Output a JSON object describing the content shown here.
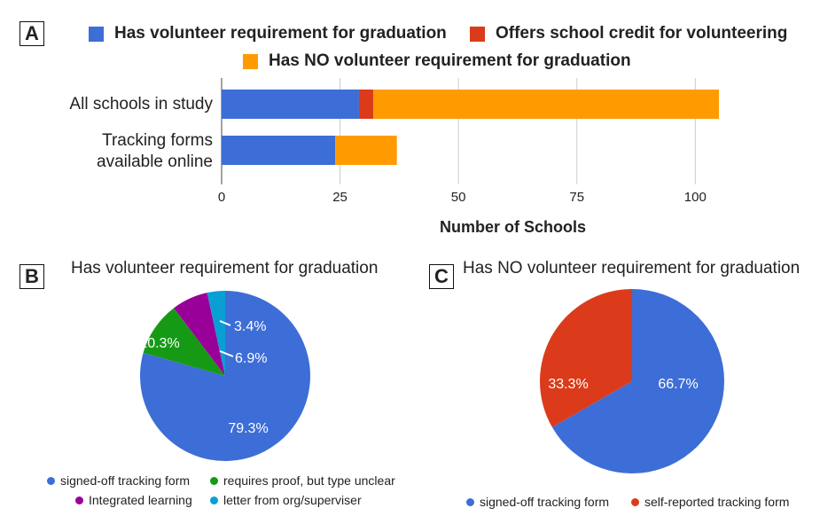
{
  "colors": {
    "blue": "#3D6DD6",
    "red": "#DB3B1A",
    "orange": "#FF9B00",
    "green": "#169A16",
    "purple": "#990099",
    "cyan": "#0A9FD4"
  },
  "panels": {
    "a": "A",
    "b": "B",
    "c": "C"
  },
  "chart_data": [
    {
      "type": "bar",
      "orientation": "horizontal",
      "stacked": true,
      "categories": [
        "All schools in study",
        "Tracking forms available online"
      ],
      "series": [
        {
          "name": "Has volunteer requirement for graduation",
          "values": [
            29,
            24
          ]
        },
        {
          "name": "Offers school credit for volunteering",
          "values": [
            3,
            0
          ]
        },
        {
          "name": "Has NO volunteer requirement for graduation",
          "values": [
            73,
            13
          ]
        }
      ],
      "xlabel": "Number of Schools",
      "xlim": [
        0,
        105
      ],
      "xticks": [
        "0",
        "25",
        "50",
        "75",
        "100"
      ],
      "grid": true,
      "legend_position": "top"
    },
    {
      "type": "pie",
      "title": "Has volunteer requirement for graduation",
      "slices": [
        {
          "label": "signed-off tracking form",
          "value": 79.3,
          "display": "79.3%"
        },
        {
          "label": "requires proof, but type unclear",
          "value": 10.3,
          "display": "10.3%"
        },
        {
          "label": "Integrated learning",
          "value": 6.9,
          "display": "6.9%"
        },
        {
          "label": "letter from org/superviser",
          "value": 3.4,
          "display": "3.4%"
        }
      ],
      "legend_position": "bottom"
    },
    {
      "type": "pie",
      "title": "Has NO volunteer requirement for graduation",
      "slices": [
        {
          "label": "signed-off tracking form",
          "value": 66.7,
          "display": "66.7%"
        },
        {
          "label": "self-reported tracking form",
          "value": 33.3,
          "display": "33.3%"
        }
      ],
      "legend_position": "bottom"
    }
  ]
}
